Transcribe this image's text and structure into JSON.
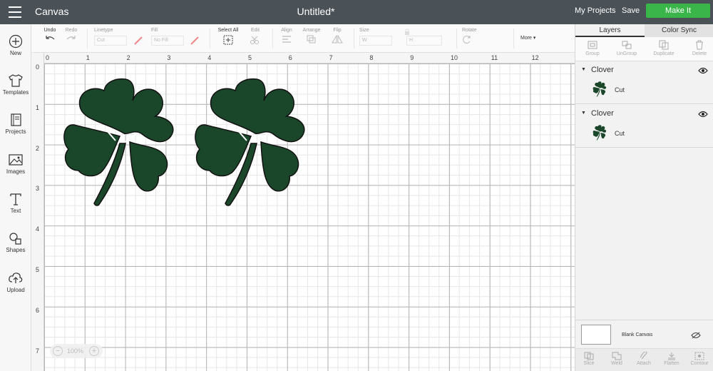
{
  "header": {
    "app_title": "Canvas",
    "doc_title": "Untitled*",
    "my_projects": "My Projects",
    "save": "Save",
    "make_it": "Make It",
    "make_it_color": "#39b54a",
    "bar_color": "#4a5157"
  },
  "nav": [
    {
      "label": "New",
      "icon": "plus-circle-icon"
    },
    {
      "label": "Templates",
      "icon": "tshirt-icon"
    },
    {
      "label": "Projects",
      "icon": "book-icon"
    },
    {
      "label": "Images",
      "icon": "image-icon"
    },
    {
      "label": "Text",
      "icon": "text-t-icon"
    },
    {
      "label": "Shapes",
      "icon": "shapes-icon"
    },
    {
      "label": "Upload",
      "icon": "cloud-upload-icon"
    }
  ],
  "toolbar": {
    "undo": "Undo",
    "redo": "Redo",
    "linetype": "Linetype",
    "linetype_value": "Cut",
    "fill": "Fill",
    "fill_value": "No Fill",
    "select_all": "Select All",
    "edit": "Edit",
    "align": "Align",
    "arrange": "Arrange",
    "flip": "Flip",
    "size": "Size",
    "width_label": "W",
    "height_label": "H",
    "rotate": "Rotate",
    "more": "More"
  },
  "ruler": {
    "top": [
      "0",
      "1",
      "2",
      "3",
      "4",
      "5",
      "6",
      "7",
      "8",
      "9",
      "10",
      "11",
      "12"
    ],
    "left": [
      "0",
      "1",
      "2",
      "3",
      "4",
      "5",
      "6",
      "7"
    ]
  },
  "zoom": {
    "value": "100%",
    "minus": "−",
    "plus": "+"
  },
  "clover_color": "#1a472a",
  "panel": {
    "tabs": [
      "Layers",
      "Color Sync"
    ],
    "layer_tools": [
      "Group",
      "UnGroup",
      "Duplicate",
      "Delete"
    ],
    "layers": [
      {
        "name": "Clover",
        "operation": "Cut"
      },
      {
        "name": "Clover",
        "operation": "Cut"
      }
    ],
    "blank_canvas": "Blank Canvas",
    "bottom_tools": [
      "Slice",
      "Weld",
      "Attach",
      "Flatten",
      "Contour"
    ]
  }
}
